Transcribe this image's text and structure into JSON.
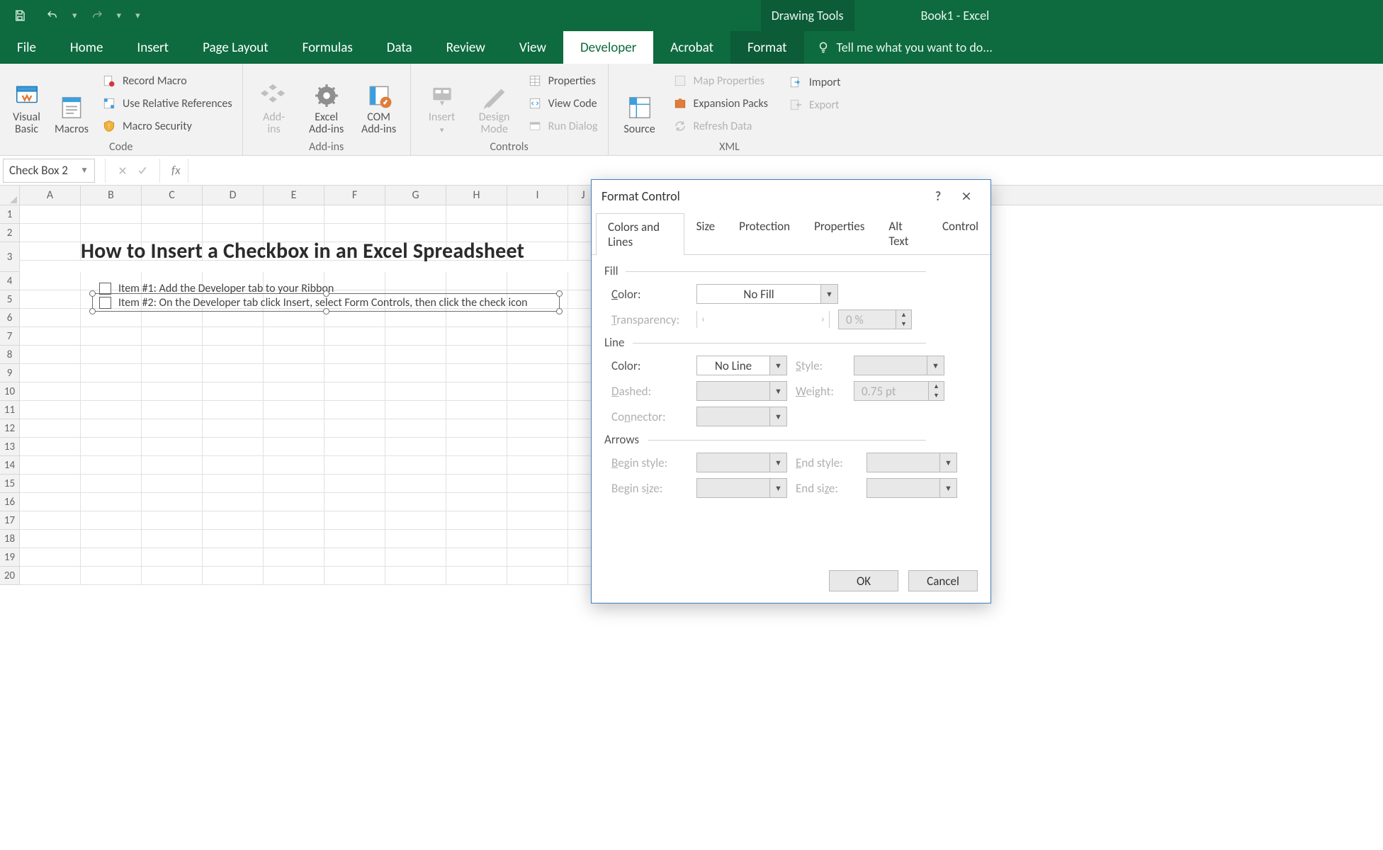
{
  "titlebar": {
    "drawing_tools_label": "Drawing Tools",
    "window_title": "Book1 - Excel"
  },
  "tabs": {
    "file": "File",
    "home": "Home",
    "insert": "Insert",
    "page_layout": "Page Layout",
    "formulas": "Formulas",
    "data": "Data",
    "review": "Review",
    "view": "View",
    "developer": "Developer",
    "acrobat": "Acrobat",
    "format": "Format",
    "tell_me": "Tell me what you want to do..."
  },
  "ribbon": {
    "code": {
      "visual_basic": "Visual",
      "visual_basic_2": "Basic",
      "macros": "Macros",
      "record_macro": "Record Macro",
      "use_relative_refs": "Use Relative References",
      "macro_security": "Macro Security",
      "group_label": "Code"
    },
    "addins": {
      "addins": "Add-",
      "addins_2": "ins",
      "excel_addins": "Excel",
      "excel_addins_2": "Add-ins",
      "com_addins": "COM",
      "com_addins_2": "Add-ins",
      "group_label": "Add-ins"
    },
    "controls": {
      "insert": "Insert",
      "design_mode": "Design",
      "design_mode_2": "Mode",
      "properties": "Properties",
      "view_code": "View Code",
      "run_dialog": "Run Dialog",
      "group_label": "Controls"
    },
    "xml": {
      "source": "Source",
      "map_properties": "Map Properties",
      "expansion_packs": "Expansion Packs",
      "refresh_data": "Refresh Data",
      "import": "Import",
      "export": "Export",
      "group_label": "XML"
    }
  },
  "formula_bar": {
    "name_box_value": "Check Box 2",
    "fx_label": "fx"
  },
  "grid": {
    "columns": [
      "A",
      "B",
      "C",
      "D",
      "E",
      "F",
      "G",
      "H",
      "I",
      "J"
    ],
    "rows": [
      "1",
      "2",
      "3",
      "4",
      "5",
      "6",
      "7",
      "8",
      "9",
      "10",
      "11",
      "12",
      "13",
      "14",
      "15",
      "16",
      "17",
      "18",
      "19",
      "20"
    ]
  },
  "sheet_content": {
    "heading": "How to Insert a Checkbox in an Excel Spreadsheet",
    "item1": "Item #1: Add the Developer tab to your Ribbon",
    "item2": "Item #2: On the Developer tab click Insert, select Form Controls, then click the check icon"
  },
  "dialog": {
    "title": "Format Control",
    "help_tooltip": "?",
    "tabs": {
      "colors_and_lines": "Colors and Lines",
      "size": "Size",
      "protection": "Protection",
      "properties": "Properties",
      "alt_text": "Alt Text",
      "control": "Control"
    },
    "fill": {
      "section": "Fill",
      "color_label": "Color:",
      "color_value": "No Fill",
      "transparency_label": "Transparency:",
      "transparency_value": "0 %"
    },
    "line": {
      "section": "Line",
      "color_label": "Color:",
      "color_value": "No Line",
      "style_label": "Style:",
      "dashed_label": "Dashed:",
      "weight_label": "Weight:",
      "weight_value": "0.75 pt",
      "connector_label": "Connector:"
    },
    "arrows": {
      "section": "Arrows",
      "begin_style": "Begin style:",
      "end_style": "End style:",
      "begin_size": "Begin size:",
      "end_size": "End size:"
    },
    "buttons": {
      "ok": "OK",
      "cancel": "Cancel"
    }
  }
}
